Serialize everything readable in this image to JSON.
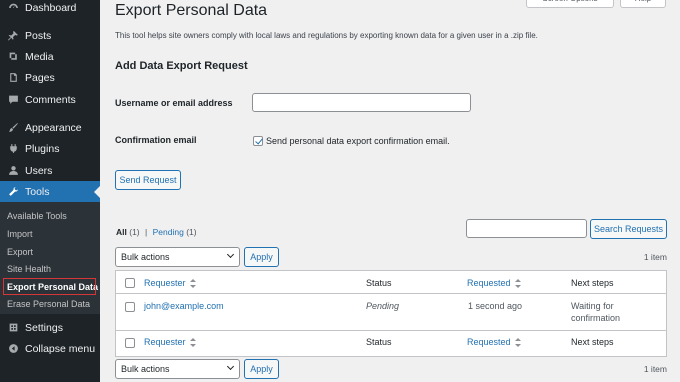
{
  "sidebar": {
    "menu": [
      {
        "label": "Dashboard",
        "icon": "dashboard-icon"
      },
      {
        "label": "Posts",
        "icon": "pin-icon"
      },
      {
        "label": "Media",
        "icon": "media-icon"
      },
      {
        "label": "Pages",
        "icon": "pages-icon"
      },
      {
        "label": "Comments",
        "icon": "comment-icon"
      },
      {
        "label": "Appearance",
        "icon": "brush-icon"
      },
      {
        "label": "Plugins",
        "icon": "plug-icon"
      },
      {
        "label": "Users",
        "icon": "user-icon"
      },
      {
        "label": "Tools",
        "icon": "wrench-icon"
      }
    ],
    "submenu": [
      "Available Tools",
      "Import",
      "Export",
      "Site Health",
      "Export Personal Data",
      "Erase Personal Data"
    ],
    "settings_label": "Settings",
    "collapse_label": "Collapse menu",
    "accent_color": "#2271b1",
    "highlight_color": "#d63638"
  },
  "header": {
    "screen_options_label": "Screen Options",
    "help_label": "Help"
  },
  "page": {
    "title": "Export Personal Data",
    "intro": "This tool helps site owners comply with local laws and regulations by exporting known data for a given user in a .zip file."
  },
  "form": {
    "heading": "Add Data Export Request",
    "username_label": "Username or email address",
    "username_value": "",
    "confirmation_label": "Confirmation email",
    "confirmation_checkbox_label": "Send personal data export confirmation email.",
    "confirmation_checked": true,
    "submit_label": "Send Request"
  },
  "list": {
    "filters": {
      "all_label": "All",
      "all_count": "(1)",
      "separator": "|",
      "pending_label": "Pending",
      "pending_count": "(1)"
    },
    "search_value": "",
    "search_button": "Search Requests",
    "bulk_select_value": "Bulk actions",
    "apply_label": "Apply",
    "items_count": "1 item",
    "columns": {
      "requester": "Requester",
      "status": "Status",
      "requested": "Requested",
      "next_steps": "Next steps"
    },
    "rows": [
      {
        "requester": "john@example.com",
        "status": "Pending",
        "requested": "1 second ago",
        "next_steps_line1": "Waiting for",
        "next_steps_line2": "confirmation"
      }
    ]
  }
}
